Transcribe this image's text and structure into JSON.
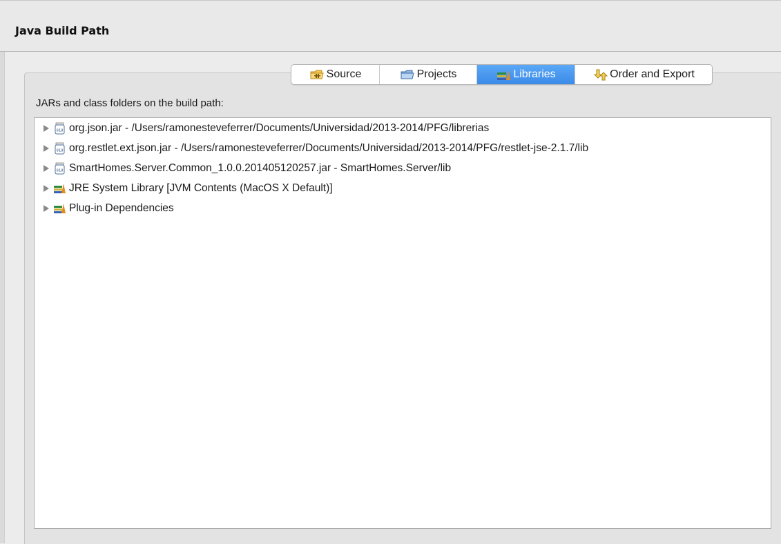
{
  "header": {
    "title": "Java Build Path"
  },
  "tabs": [
    {
      "label": "Source",
      "icon": "source-folder-icon",
      "selected": false
    },
    {
      "label": "Projects",
      "icon": "projects-folder-icon",
      "selected": false
    },
    {
      "label": "Libraries",
      "icon": "libraries-icon",
      "selected": true
    },
    {
      "label": "Order and Export",
      "icon": "order-export-icon",
      "selected": false
    }
  ],
  "libraries_pane": {
    "label": "JARs and class folders on the build path:",
    "items": [
      {
        "label": "org.json.jar - /Users/ramonesteveferrer/Documents/Universidad/2013-2014/PFG/librerias",
        "icon": "jar-icon"
      },
      {
        "label": "org.restlet.ext.json.jar - /Users/ramonesteveferrer/Documents/Universidad/2013-2014/PFG/restlet-jse-2.1.7/lib",
        "icon": "jar-icon"
      },
      {
        "label": "SmartHomes.Server.Common_1.0.0.201405120257.jar - SmartHomes.Server/lib",
        "icon": "jar-icon"
      },
      {
        "label": "JRE System Library [JVM Contents (MacOS X Default)]",
        "icon": "library-icon"
      },
      {
        "label": "Plug-in Dependencies",
        "icon": "library-icon"
      }
    ]
  },
  "colors": {
    "selected_tab": "#3b8ae8",
    "background": "#ececec",
    "tree_background": "#ffffff"
  }
}
